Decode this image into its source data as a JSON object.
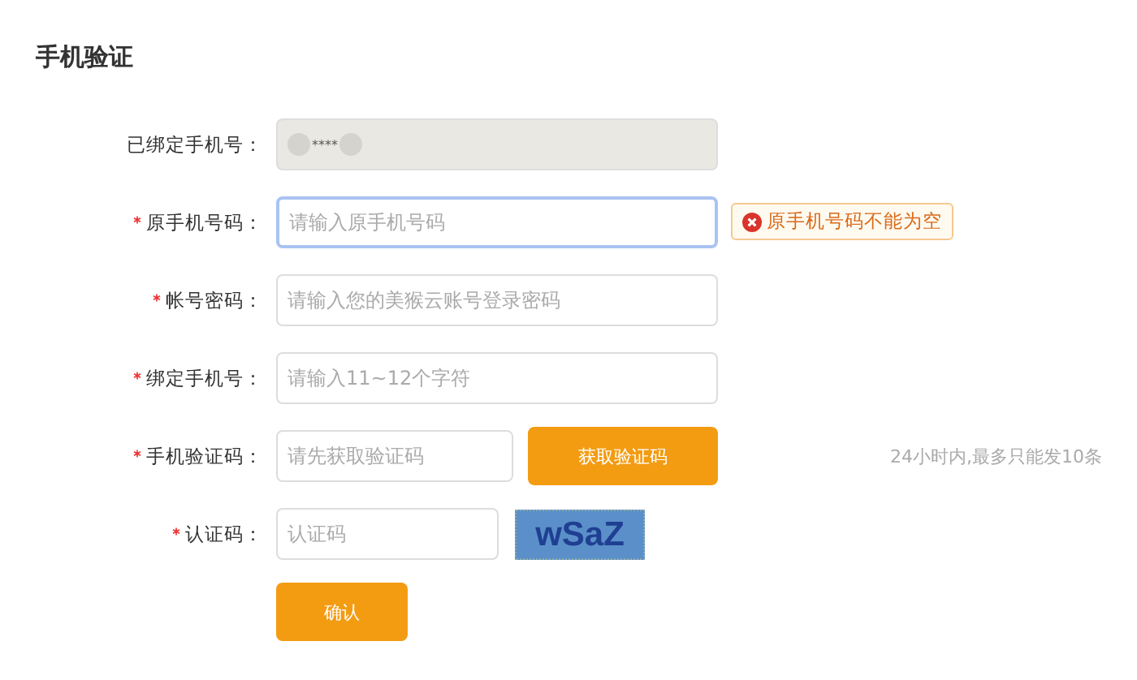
{
  "title": "手机验证",
  "rows": [
    {
      "kind": "readonly",
      "label": "已绑定手机号：",
      "required": false,
      "value": "****"
    },
    {
      "kind": "input",
      "label": "原手机号码：",
      "required": true,
      "placeholder": "请输入原手机号码",
      "focused": true,
      "error": "原手机号码不能为空"
    },
    {
      "kind": "input",
      "label": "帐号密码：",
      "required": true,
      "placeholder": "请输入您的美猴云账号登录密码",
      "focused": false
    },
    {
      "kind": "input",
      "label": "绑定手机号：",
      "required": true,
      "placeholder": "请输入11~12个字符",
      "focused": false
    },
    {
      "kind": "code",
      "label": "手机验证码：",
      "required": true,
      "placeholder": "请先获取验证码",
      "focused": false,
      "button": "获取验证码",
      "note": "24小时内,最多只能发10条"
    },
    {
      "kind": "captcha",
      "label": "认证码：",
      "required": true,
      "placeholder": "认证码",
      "focused": false,
      "captcha": "wSaZ"
    }
  ],
  "submit": "确认"
}
